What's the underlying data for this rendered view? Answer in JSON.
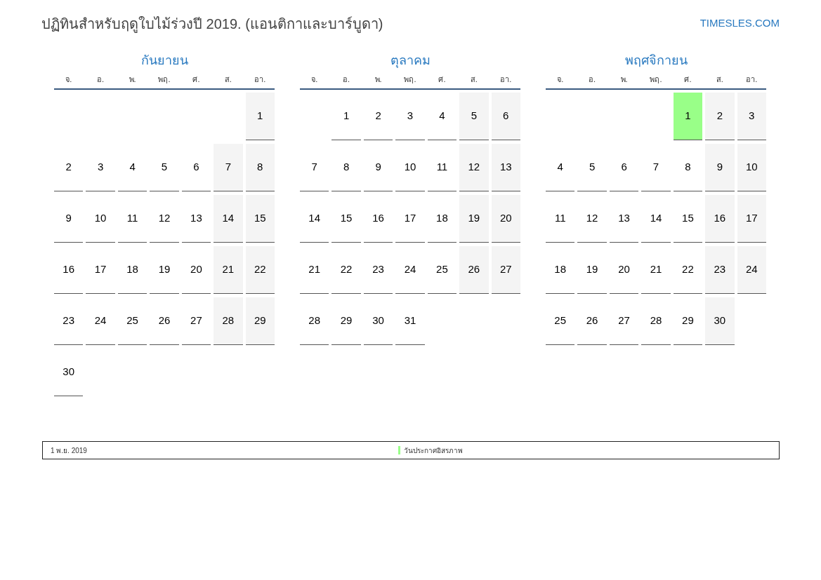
{
  "title": "ปฏิทินสำหรับฤดูใบไม้ร่วงปี 2019. (แอนติกาและบาร์บูดา)",
  "site_link": "TIMESLES.COM",
  "months": [
    {
      "name": "กันยายน",
      "weekdays": [
        "จ.",
        "อ.",
        "พ.",
        "พฤ.",
        "ศ.",
        "ส.",
        "อา."
      ],
      "weeks": [
        [
          {
            "kind": "empty"
          },
          {
            "kind": "empty"
          },
          {
            "kind": "empty"
          },
          {
            "kind": "empty"
          },
          {
            "kind": "empty"
          },
          {
            "kind": "empty"
          },
          {
            "day": "1",
            "kind": "weekend"
          }
        ],
        [
          {
            "day": "2",
            "kind": "weekday"
          },
          {
            "day": "3",
            "kind": "weekday"
          },
          {
            "day": "4",
            "kind": "weekday"
          },
          {
            "day": "5",
            "kind": "weekday"
          },
          {
            "day": "6",
            "kind": "weekday"
          },
          {
            "day": "7",
            "kind": "weekend"
          },
          {
            "day": "8",
            "kind": "weekend"
          }
        ],
        [
          {
            "day": "9",
            "kind": "weekday"
          },
          {
            "day": "10",
            "kind": "weekday"
          },
          {
            "day": "11",
            "kind": "weekday"
          },
          {
            "day": "12",
            "kind": "weekday"
          },
          {
            "day": "13",
            "kind": "weekday"
          },
          {
            "day": "14",
            "kind": "weekend"
          },
          {
            "day": "15",
            "kind": "weekend"
          }
        ],
        [
          {
            "day": "16",
            "kind": "weekday"
          },
          {
            "day": "17",
            "kind": "weekday"
          },
          {
            "day": "18",
            "kind": "weekday"
          },
          {
            "day": "19",
            "kind": "weekday"
          },
          {
            "day": "20",
            "kind": "weekday"
          },
          {
            "day": "21",
            "kind": "weekend"
          },
          {
            "day": "22",
            "kind": "weekend"
          }
        ],
        [
          {
            "day": "23",
            "kind": "weekday"
          },
          {
            "day": "24",
            "kind": "weekday"
          },
          {
            "day": "25",
            "kind": "weekday"
          },
          {
            "day": "26",
            "kind": "weekday"
          },
          {
            "day": "27",
            "kind": "weekday"
          },
          {
            "day": "28",
            "kind": "weekend"
          },
          {
            "day": "29",
            "kind": "weekend"
          }
        ],
        [
          {
            "day": "30",
            "kind": "weekday"
          }
        ]
      ]
    },
    {
      "name": "ตุลาคม",
      "weekdays": [
        "จ.",
        "อ.",
        "พ.",
        "พฤ.",
        "ศ.",
        "ส.",
        "อา."
      ],
      "weeks": [
        [
          {
            "kind": "empty"
          },
          {
            "day": "1",
            "kind": "weekday"
          },
          {
            "day": "2",
            "kind": "weekday"
          },
          {
            "day": "3",
            "kind": "weekday"
          },
          {
            "day": "4",
            "kind": "weekday"
          },
          {
            "day": "5",
            "kind": "weekend"
          },
          {
            "day": "6",
            "kind": "weekend"
          }
        ],
        [
          {
            "day": "7",
            "kind": "weekday"
          },
          {
            "day": "8",
            "kind": "weekday"
          },
          {
            "day": "9",
            "kind": "weekday"
          },
          {
            "day": "10",
            "kind": "weekday"
          },
          {
            "day": "11",
            "kind": "weekday"
          },
          {
            "day": "12",
            "kind": "weekend"
          },
          {
            "day": "13",
            "kind": "weekend"
          }
        ],
        [
          {
            "day": "14",
            "kind": "weekday"
          },
          {
            "day": "15",
            "kind": "weekday"
          },
          {
            "day": "16",
            "kind": "weekday"
          },
          {
            "day": "17",
            "kind": "weekday"
          },
          {
            "day": "18",
            "kind": "weekday"
          },
          {
            "day": "19",
            "kind": "weekend"
          },
          {
            "day": "20",
            "kind": "weekend"
          }
        ],
        [
          {
            "day": "21",
            "kind": "weekday"
          },
          {
            "day": "22",
            "kind": "weekday"
          },
          {
            "day": "23",
            "kind": "weekday"
          },
          {
            "day": "24",
            "kind": "weekday"
          },
          {
            "day": "25",
            "kind": "weekday"
          },
          {
            "day": "26",
            "kind": "weekend"
          },
          {
            "day": "27",
            "kind": "weekend"
          }
        ],
        [
          {
            "day": "28",
            "kind": "weekday"
          },
          {
            "day": "29",
            "kind": "weekday"
          },
          {
            "day": "30",
            "kind": "weekday"
          },
          {
            "day": "31",
            "kind": "weekday"
          }
        ]
      ]
    },
    {
      "name": "พฤศจิกายน",
      "weekdays": [
        "จ.",
        "อ.",
        "พ.",
        "พฤ.",
        "ศ.",
        "ส.",
        "อา."
      ],
      "weeks": [
        [
          {
            "kind": "empty"
          },
          {
            "kind": "empty"
          },
          {
            "kind": "empty"
          },
          {
            "kind": "empty"
          },
          {
            "day": "1",
            "kind": "holiday",
            "color": "#99ff88"
          },
          {
            "day": "2",
            "kind": "weekend"
          },
          {
            "day": "3",
            "kind": "weekend"
          }
        ],
        [
          {
            "day": "4",
            "kind": "weekday"
          },
          {
            "day": "5",
            "kind": "weekday"
          },
          {
            "day": "6",
            "kind": "weekday"
          },
          {
            "day": "7",
            "kind": "weekday"
          },
          {
            "day": "8",
            "kind": "weekday"
          },
          {
            "day": "9",
            "kind": "weekend"
          },
          {
            "day": "10",
            "kind": "weekend"
          }
        ],
        [
          {
            "day": "11",
            "kind": "weekday"
          },
          {
            "day": "12",
            "kind": "weekday"
          },
          {
            "day": "13",
            "kind": "weekday"
          },
          {
            "day": "14",
            "kind": "weekday"
          },
          {
            "day": "15",
            "kind": "weekday"
          },
          {
            "day": "16",
            "kind": "weekend"
          },
          {
            "day": "17",
            "kind": "weekend"
          }
        ],
        [
          {
            "day": "18",
            "kind": "weekday"
          },
          {
            "day": "19",
            "kind": "weekday"
          },
          {
            "day": "20",
            "kind": "weekday"
          },
          {
            "day": "21",
            "kind": "weekday"
          },
          {
            "day": "22",
            "kind": "weekday"
          },
          {
            "day": "23",
            "kind": "weekend"
          },
          {
            "day": "24",
            "kind": "weekend"
          }
        ],
        [
          {
            "day": "25",
            "kind": "weekday"
          },
          {
            "day": "26",
            "kind": "weekday"
          },
          {
            "day": "27",
            "kind": "weekday"
          },
          {
            "day": "28",
            "kind": "weekday"
          },
          {
            "day": "29",
            "kind": "weekday"
          },
          {
            "day": "30",
            "kind": "weekend"
          }
        ]
      ]
    }
  ],
  "legend": [
    {
      "date": "1 พ.ย. 2019",
      "name": "วันประกาศอิสรภาพ",
      "color": "#99ff88"
    }
  ]
}
